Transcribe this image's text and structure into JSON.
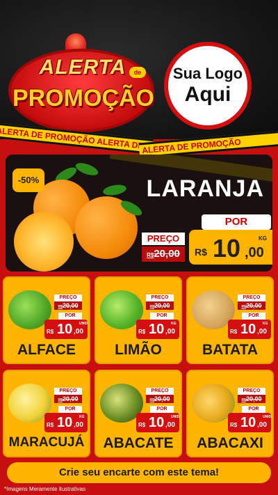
{
  "header": {
    "badge_line1": "ALERTA",
    "badge_de": "de",
    "badge_line2": "PROMOÇÃO",
    "logo_line1": "Sua Logo",
    "logo_line2": "Aqui",
    "tape_text": "ALERTA DE PROMOÇÃO ALERTA DE PROMOÇÃO",
    "tape_text_right": "ALERTA DE PROMOÇÃO"
  },
  "hero": {
    "discount": "-50%",
    "name": "LARANJA",
    "preco_label": "PREÇO",
    "old_currency": "R$",
    "old_price": "20,00",
    "por_label": "POR",
    "currency": "R$",
    "price_int": "10",
    "price_dec": ",00",
    "unit": "KG"
  },
  "products": [
    {
      "name": "ALFACE",
      "preco_label": "PREÇO",
      "old_currency": "R$",
      "old_price": "20,00",
      "por_label": "POR",
      "currency": "R$",
      "price_int": "10",
      "price_dec": ",00",
      "unit": "UNID",
      "image_icon": "lettuce-icon"
    },
    {
      "name": "LIMÃO",
      "preco_label": "PREÇO",
      "old_currency": "R$",
      "old_price": "20,00",
      "por_label": "POR",
      "currency": "R$",
      "price_int": "10",
      "price_dec": ",00",
      "unit": "KG",
      "image_icon": "lime-icon"
    },
    {
      "name": "BATATA",
      "preco_label": "PREÇO",
      "old_currency": "R$",
      "old_price": "20,00",
      "por_label": "POR",
      "currency": "R$",
      "price_int": "10",
      "price_dec": ",00",
      "unit": "KG",
      "image_icon": "potato-icon"
    },
    {
      "name": "MARACUJÁ",
      "preco_label": "PREÇO",
      "old_currency": "R$",
      "old_price": "20,00",
      "por_label": "POR",
      "currency": "R$",
      "price_int": "10",
      "price_dec": ",00",
      "unit": "KG",
      "image_icon": "passion-fruit-icon"
    },
    {
      "name": "ABACATE",
      "preco_label": "PREÇO",
      "old_currency": "R$",
      "old_price": "20,00",
      "por_label": "POR",
      "currency": "R$",
      "price_int": "10",
      "price_dec": ",00",
      "unit": "UNID",
      "image_icon": "avocado-icon"
    },
    {
      "name": "ABACAXI",
      "preco_label": "PREÇO",
      "old_currency": "R$",
      "old_price": "20,00",
      "por_label": "POR",
      "currency": "R$",
      "price_int": "10",
      "price_dec": ",00",
      "unit": "UNID",
      "image_icon": "pineapple-icon"
    }
  ],
  "cta": "Crie seu encarte com este tema!",
  "disclaimer": "*Imagens Meramente Ilustrativas",
  "colors": {
    "background_red": "#c80f0f",
    "card_yellow": "#ffb400",
    "price_red": "#d40f0f",
    "header_dark": "#141414"
  }
}
